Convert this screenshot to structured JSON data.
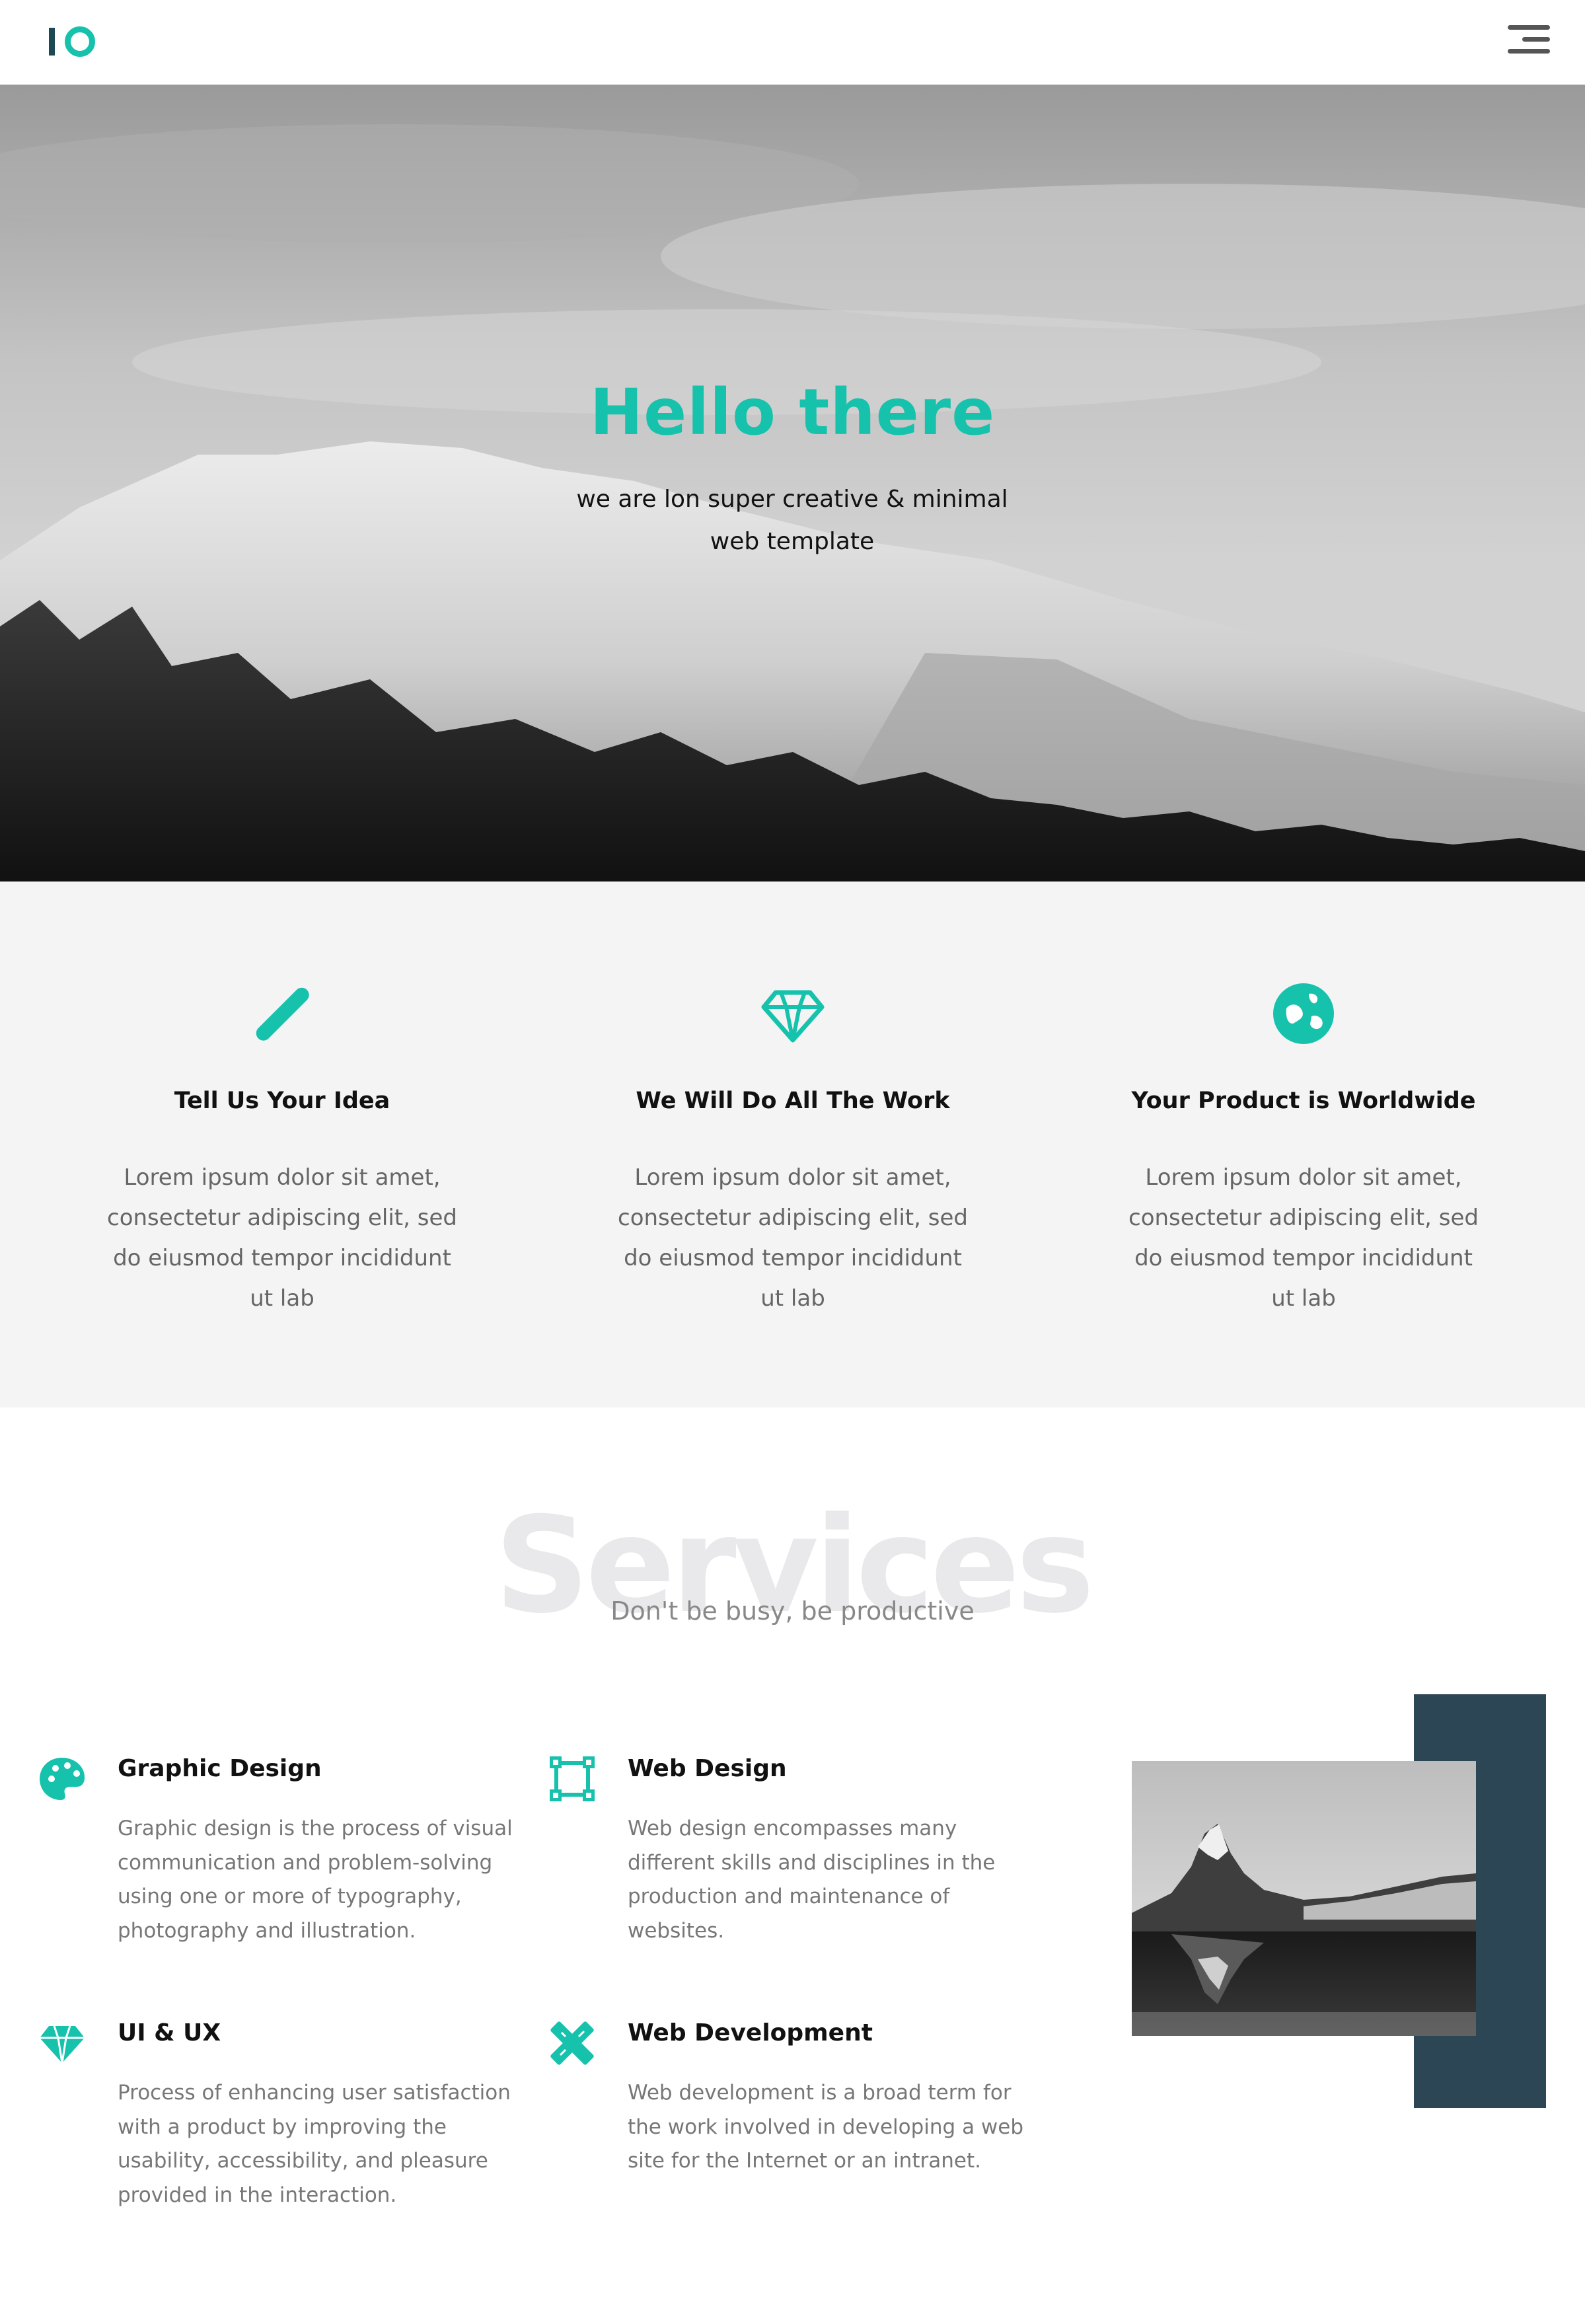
{
  "header": {
    "logo_label": "IO",
    "menu_icon": "hamburger-menu-icon"
  },
  "hero": {
    "title": "Hello there",
    "subtitle": "we are lon super creative & minimal web template"
  },
  "features": [
    {
      "icon": "pencil-icon",
      "title": "Tell Us Your Idea",
      "text": "Lorem ipsum dolor sit amet, consectetur adipiscing elit, sed do eiusmod tempor incididunt ut lab"
    },
    {
      "icon": "diamond-icon",
      "title": "We Will Do All The Work",
      "text": "Lorem ipsum dolor sit amet, consectetur adipiscing elit, sed do eiusmod tempor incididunt ut lab"
    },
    {
      "icon": "globe-icon",
      "title": "Your Product is Worldwide",
      "text": "Lorem ipsum dolor sit amet, consectetur adipiscing elit, sed do eiusmod tempor incididunt ut lab"
    }
  ],
  "services": {
    "heading": "Services",
    "subheading": "Don't be busy, be productive",
    "items": [
      {
        "icon": "palette-icon",
        "title": "Graphic Design",
        "text": "Graphic design is the process of visual communication and problem-solving using one or more of typography, photography and illustration."
      },
      {
        "icon": "vector-square-icon",
        "title": "Web Design",
        "text": "Web design encompasses many different skills and disciplines in the production and maintenance of websites."
      },
      {
        "icon": "gem-icon",
        "title": "UI & UX",
        "text": "Process of enhancing user satisfaction with a product by improving the usability, accessibility, and pleasure provided in the interaction."
      },
      {
        "icon": "pencil-ruler-icon",
        "title": "Web Development",
        "text": "Web development is a broad term for the work involved in developing a web site for the Internet or an intranet."
      }
    ]
  },
  "colors": {
    "accent": "#17c2ad",
    "navy": "#2d4656",
    "feature_bg": "#f4f4f4",
    "watermark": "#e9e9eb"
  }
}
